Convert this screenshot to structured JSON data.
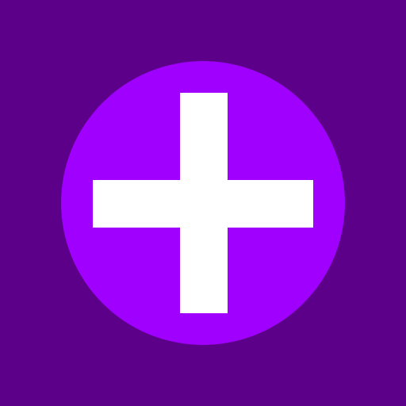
{
  "app": {
    "background_color": "#5C0089"
  },
  "add_button": {
    "icon": "plus-icon",
    "fill_color": "#A000FE",
    "icon_color": "#FFFFFF"
  }
}
